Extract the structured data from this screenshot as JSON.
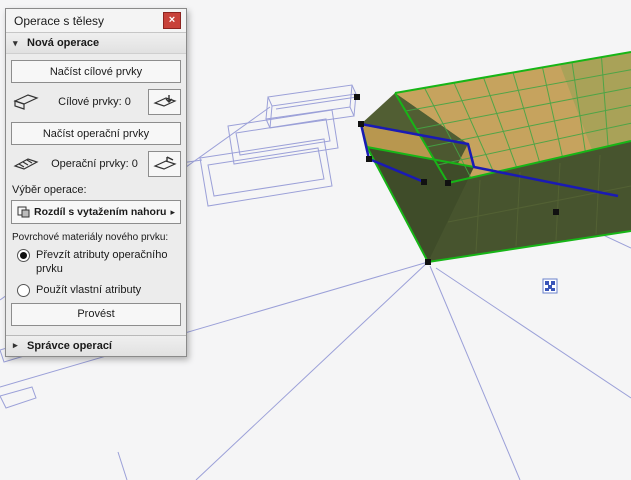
{
  "window": {
    "close_glyph": "×"
  },
  "dialog": {
    "title": "Operace s tělesy",
    "section_new": {
      "glyph": "▾",
      "label": "Nová operace"
    },
    "load_targets_button": "Načíst cílové prvky",
    "targets_counter": "Cílové prvky: 0",
    "load_operators_button": "Načíst operační prvky",
    "operators_counter": "Operační prvky: 0",
    "operation_label": "Výběr operace:",
    "operation_value": "Rozdíl s vytažením nahoru",
    "operation_arrow": "▸",
    "materials_label": "Povrchové materiály nového prvku:",
    "radio_inherit": {
      "label": "Převzít atributy operačního prvku",
      "checked": true
    },
    "radio_custom": {
      "label": "Použít vlastní atributy",
      "checked": false
    },
    "execute_button": "Provést",
    "section_manager": {
      "glyph": "▸",
      "label": "Správce operací"
    }
  },
  "viewport": {
    "colors": {
      "background": "#f5f5f6",
      "wireframe": "#9ba0d8",
      "target_outline_green": "#17b517",
      "operator_outline_blue": "#1a1ab4",
      "selection_handle": "#111111",
      "deck_top": "#c6a35e",
      "deck_side": "#46522f"
    }
  }
}
